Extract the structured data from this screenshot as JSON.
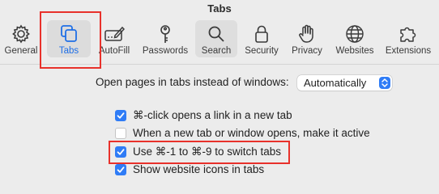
{
  "window": {
    "title": "Tabs"
  },
  "toolbar": {
    "items": [
      {
        "label": "General",
        "icon": "gear-icon"
      },
      {
        "label": "Tabs",
        "icon": "tabs-icon",
        "selected": true
      },
      {
        "label": "AutoFill",
        "icon": "autofill-icon"
      },
      {
        "label": "Passwords",
        "icon": "key-icon"
      },
      {
        "label": "Search",
        "icon": "magnifier-icon"
      },
      {
        "label": "Security",
        "icon": "lock-icon"
      },
      {
        "label": "Privacy",
        "icon": "hand-icon"
      },
      {
        "label": "Websites",
        "icon": "globe-icon"
      },
      {
        "label": "Extensions",
        "icon": "puzzle-icon"
      }
    ]
  },
  "settings": {
    "open_pages_label": "Open pages in tabs instead of windows:",
    "open_pages_value": "Automatically",
    "checkboxes": [
      {
        "label": "⌘-click opens a link in a new tab",
        "checked": true
      },
      {
        "label": "When a new tab or window opens, make it active",
        "checked": false
      },
      {
        "label": "Use ⌘-1 to ⌘-9 to switch tabs",
        "checked": true
      },
      {
        "label": "Show website icons in tabs",
        "checked": true
      }
    ]
  },
  "colors": {
    "accent": "#2f7cf6",
    "highlight": "#e8312b",
    "background": "#ececec"
  }
}
